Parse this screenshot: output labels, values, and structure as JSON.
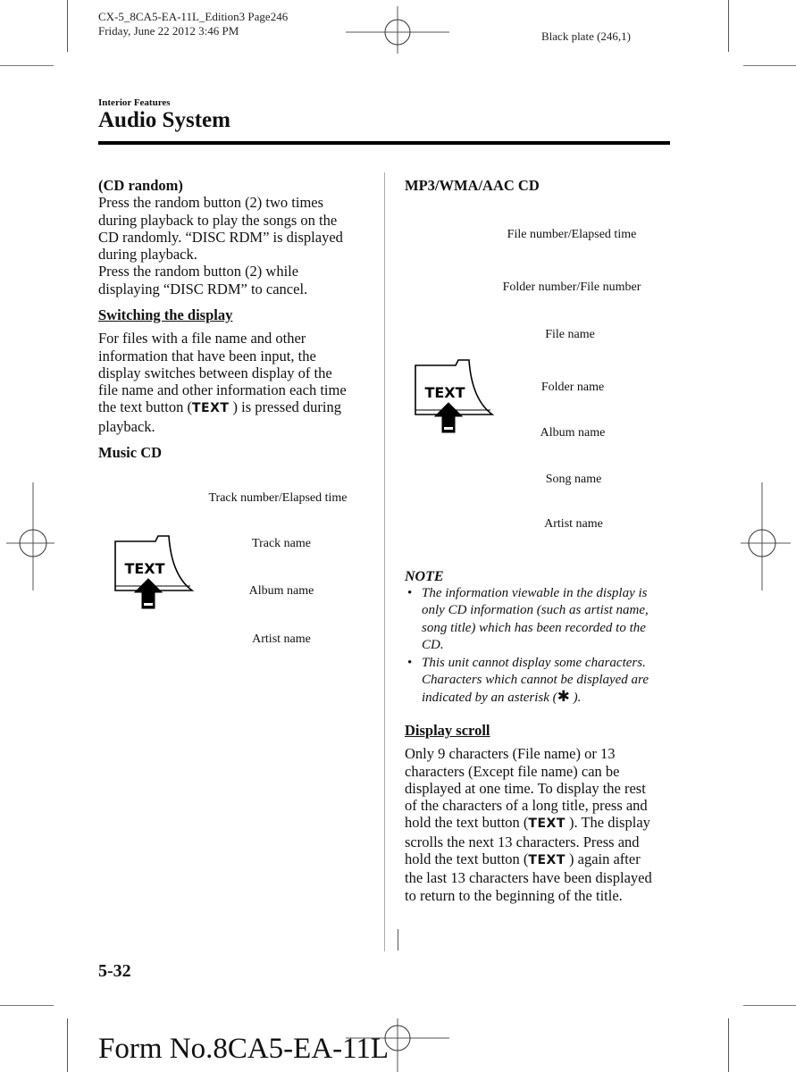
{
  "slug": {
    "job_line": "CX-5_8CA5-EA-11L_Edition3 Page246",
    "date_line": "Friday, June 22 2012 3:46 PM",
    "plate": "Black plate (246,1)"
  },
  "header": {
    "section": "Interior Features",
    "title": "Audio System"
  },
  "left_column": {
    "cd_random": {
      "heading": "(CD random)",
      "lines": [
        "Press the random button (2) two times",
        "during playback to play the songs on the",
        "CD randomly. “DISC RDM” is displayed",
        "during playback.",
        "Press the random button (2) while",
        "displaying “DISC RDM” to cancel."
      ]
    },
    "switching": {
      "heading": "Switching the display",
      "lines": [
        "For files with a file name and other",
        "information that have been input, the",
        "display switches between display of the",
        "file name and other information each time"
      ],
      "line5_before": "the text button (",
      "line5_key": "TEXT",
      "line5_after": " ) is pressed during",
      "line6": "playback."
    },
    "music_cd": {
      "heading": "Music CD",
      "button_label": "TEXT",
      "items": [
        "Track number/Elapsed time",
        "Track name",
        "Album name",
        "Artist name"
      ]
    }
  },
  "right_column": {
    "mp3": {
      "heading": "MP3/WMA/AAC CD",
      "button_label": "TEXT",
      "items": [
        "File number/Elapsed time",
        "Folder number/File number",
        "File name",
        "Folder name",
        "Album name",
        "Song name",
        "Artist name"
      ]
    },
    "note": {
      "title": "NOTE",
      "bullet": "•",
      "item1_lines": [
        "The information viewable in the display is",
        "only CD information (such as artist name,",
        "song title) which has been recorded to the",
        "CD."
      ],
      "item2_lines": [
        "This unit cannot display some characters.",
        "Characters which cannot be displayed are"
      ],
      "item2_last_before": "indicated by an asterisk (",
      "asterisk": "✱",
      "item2_last_after": " )."
    },
    "display_scroll": {
      "heading": "Display scroll",
      "l1": "Only 9 characters (File name) or 13",
      "l2": "characters (Except file name) can be",
      "l3": "displayed at one time. To display the rest",
      "l4": "of the characters of a long title, press and",
      "l5_before": "hold the text button (",
      "l5_key": "TEXT",
      "l5_after": " ). The display",
      "l6": "scrolls the next 13 characters. Press and",
      "l7_before": "hold the text button (",
      "l7_key": "TEXT",
      "l7_after": " ) again after",
      "l8": "the last 13 characters have been displayed",
      "l9": "to return to the beginning of the title."
    }
  },
  "footer": {
    "page_number": "5-32",
    "form_number": "Form No.8CA5-EA-11L"
  }
}
